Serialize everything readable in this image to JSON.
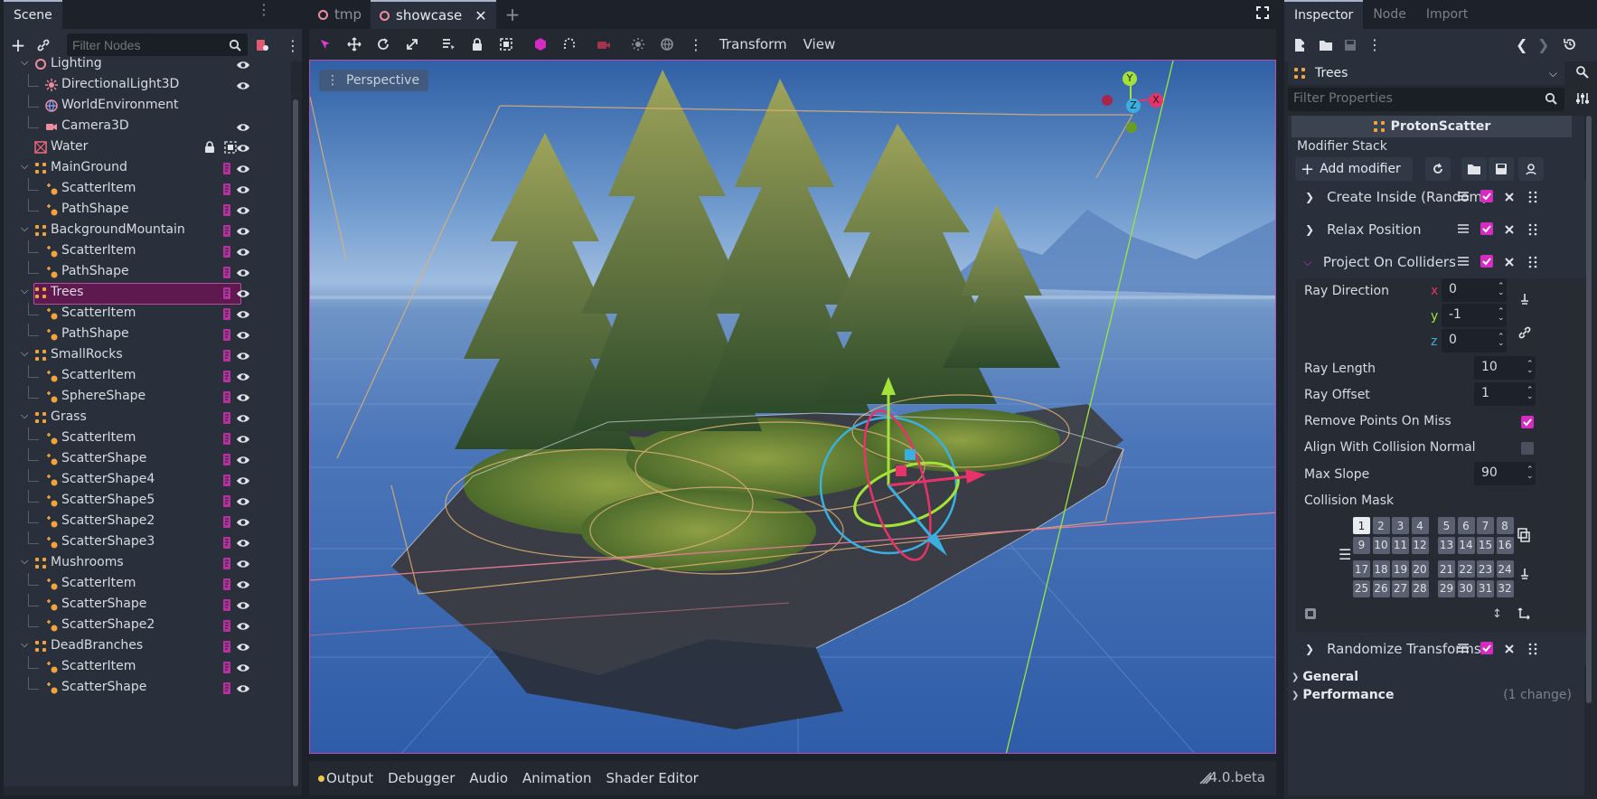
{
  "scene_dock": {
    "tab_scene": "Scene",
    "filter_placeholder": "Filter Nodes",
    "nodes": [
      {
        "label": "Lighting",
        "depth": 0
      },
      {
        "label": "DirectionalLight3D",
        "depth": 1
      },
      {
        "label": "WorldEnvironment",
        "depth": 1
      },
      {
        "label": "Camera3D",
        "depth": 1
      },
      {
        "label": "Water",
        "depth": 0
      },
      {
        "label": "MainGround",
        "depth": 0
      },
      {
        "label": "ScatterItem",
        "depth": 1
      },
      {
        "label": "PathShape",
        "depth": 1
      },
      {
        "label": "BackgroundMountain",
        "depth": 0
      },
      {
        "label": "ScatterItem",
        "depth": 1
      },
      {
        "label": "PathShape",
        "depth": 1
      },
      {
        "label": "Trees",
        "depth": 0,
        "selected": true
      },
      {
        "label": "ScatterItem",
        "depth": 1
      },
      {
        "label": "PathShape",
        "depth": 1
      },
      {
        "label": "SmallRocks",
        "depth": 0
      },
      {
        "label": "ScatterItem",
        "depth": 1
      },
      {
        "label": "SphereShape",
        "depth": 1
      },
      {
        "label": "Grass",
        "depth": 0
      },
      {
        "label": "ScatterItem",
        "depth": 1
      },
      {
        "label": "ScatterShape",
        "depth": 1
      },
      {
        "label": "ScatterShape4",
        "depth": 1
      },
      {
        "label": "ScatterShape5",
        "depth": 1
      },
      {
        "label": "ScatterShape2",
        "depth": 1
      },
      {
        "label": "ScatterShape3",
        "depth": 1
      },
      {
        "label": "Mushrooms",
        "depth": 0
      },
      {
        "label": "ScatterItem",
        "depth": 1
      },
      {
        "label": "ScatterShape",
        "depth": 1
      },
      {
        "label": "ScatterShape2",
        "depth": 1
      },
      {
        "label": "DeadBranches",
        "depth": 0
      },
      {
        "label": "ScatterItem",
        "depth": 1
      },
      {
        "label": "ScatterShape",
        "depth": 1
      }
    ]
  },
  "editor_tabs": {
    "tab1": "tmp",
    "tab2": "showcase"
  },
  "viewport_toolbar": {
    "transform": "Transform",
    "view": "View"
  },
  "viewport": {
    "mode": "Perspective",
    "gizmo_x": "X",
    "gizmo_y": "Y",
    "gizmo_z": "Z"
  },
  "bottom_panel": {
    "output": "Output",
    "debugger": "Debugger",
    "audio": "Audio",
    "animation": "Animation",
    "shader": "Shader Editor",
    "version": "4.0.beta"
  },
  "inspector": {
    "tab_inspector": "Inspector",
    "tab_node": "Node",
    "tab_import": "Import",
    "object": "Trees",
    "filter_placeholder": "Filter Properties",
    "class_header": "ProtonScatter",
    "modifier_stack": "Modifier Stack",
    "add_modifier": "Add modifier",
    "modifiers": [
      "Create Inside (Random)",
      "Relax Position",
      "Project On Colliders",
      "Randomize Transforms"
    ],
    "ray_direction": {
      "label": "Ray Direction",
      "x": "0",
      "y": "-1",
      "z": "0",
      "x_axis": "x",
      "y_axis": "y",
      "z_axis": "z"
    },
    "ray_length": {
      "label": "Ray Length",
      "value": "10"
    },
    "ray_offset": {
      "label": "Ray Offset",
      "value": "1"
    },
    "remove_points": {
      "label": "Remove Points On Miss",
      "checked": true
    },
    "align_normal": {
      "label": "Align With Collision Normal",
      "checked": false
    },
    "max_slope": {
      "label": "Max Slope",
      "value": "90"
    },
    "collision_mask": {
      "label": "Collision Mask",
      "layers": [
        "1",
        "2",
        "3",
        "4",
        "5",
        "6",
        "7",
        "8",
        "9",
        "10",
        "11",
        "12",
        "13",
        "14",
        "15",
        "16",
        "17",
        "18",
        "19",
        "20",
        "21",
        "22",
        "23",
        "24",
        "25",
        "26",
        "27",
        "28",
        "29",
        "30",
        "31",
        "32"
      ],
      "active": [
        "1"
      ]
    },
    "general": "General",
    "performance": "Performance",
    "changes": "(1 change)"
  },
  "colors": {
    "accent": "#d42bc1",
    "selection": "#5e1a4f",
    "node_orange": "#f2a33a"
  }
}
